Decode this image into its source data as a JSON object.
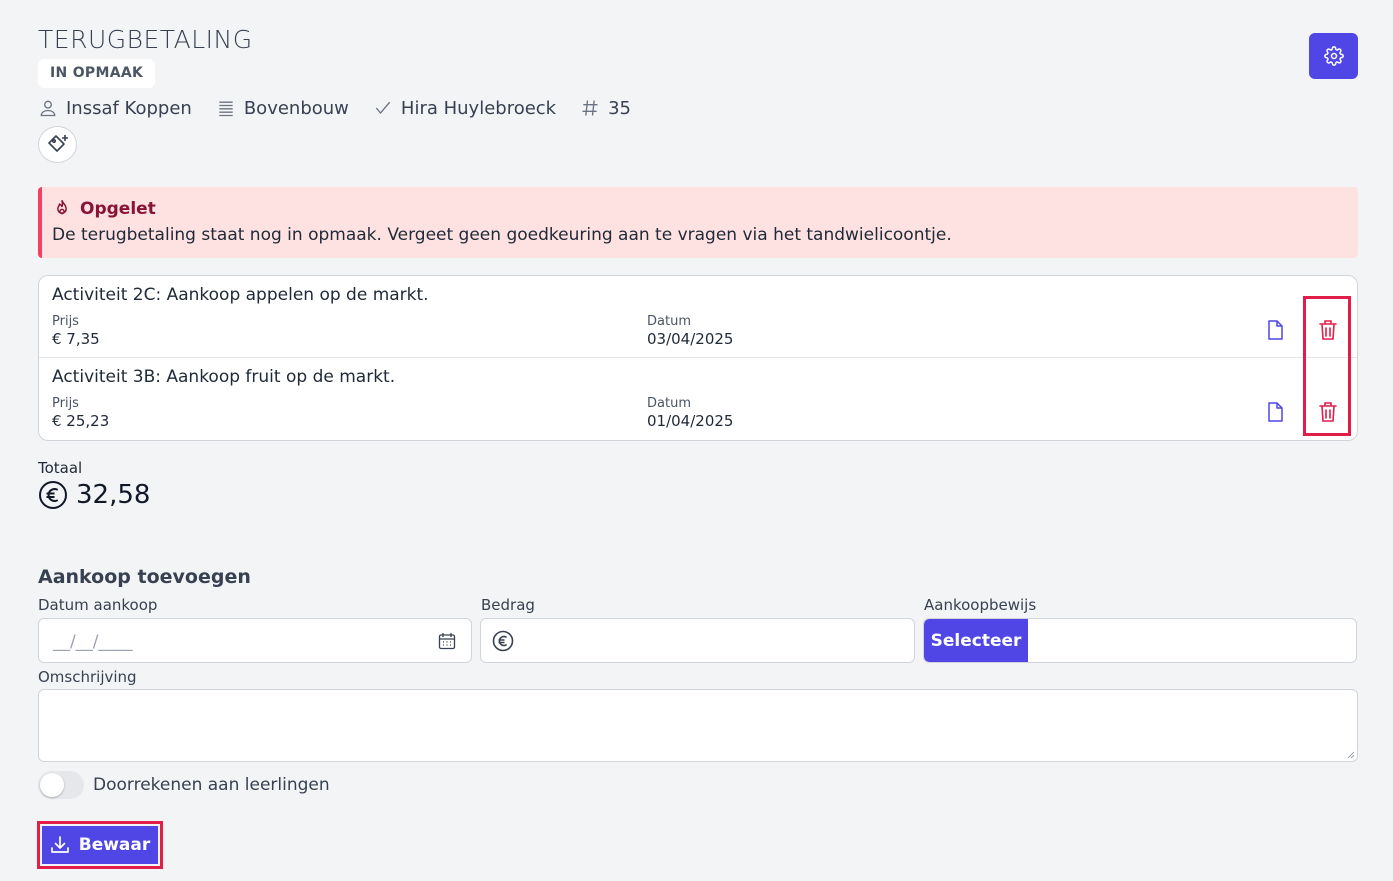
{
  "header": {
    "title": "TERUGBETALING",
    "status": "IN OPMAAK",
    "meta": {
      "person": "Inssaf Koppen",
      "group": "Bovenbouw",
      "approver": "Hira Huylebroeck",
      "number": "35"
    },
    "icons": {
      "settings": "gear-icon",
      "person": "user-icon",
      "group": "list-icon",
      "approver": "check-icon",
      "number": "hash-icon",
      "tag": "tag-add-icon"
    }
  },
  "alert": {
    "title": "Opgelet",
    "text": "De terugbetaling staat nog in opmaak. Vergeet geen goedkeuring aan te vragen via het tandwielicoontje.",
    "icon": "fire-icon"
  },
  "items": [
    {
      "title": "Activiteit 2C: Aankoop appelen op de markt.",
      "price_label": "Prijs",
      "price": "€ 7,35",
      "date_label": "Datum",
      "date": "03/04/2025"
    },
    {
      "title": "Activiteit 3B: Aankoop fruit op de markt.",
      "price_label": "Prijs",
      "price": "€ 25,23",
      "date_label": "Datum",
      "date": "01/04/2025"
    }
  ],
  "total": {
    "label": "Totaal",
    "value": "32,58"
  },
  "form": {
    "title": "Aankoop toevoegen",
    "date_label": "Datum aankoop",
    "date_placeholder": "__/__/____",
    "amount_label": "Bedrag",
    "receipt_label": "Aankoopbewijs",
    "select_button": "Selecteer",
    "description_label": "Omschrijving",
    "toggle_label": "Doorrekenen aan leerlingen",
    "toggle_on": false,
    "save_button": "Bewaar"
  },
  "colors": {
    "primary": "#4f46e5",
    "danger": "#e11d48",
    "alert_bg": "#fee2e2",
    "alert_title": "#881337"
  }
}
